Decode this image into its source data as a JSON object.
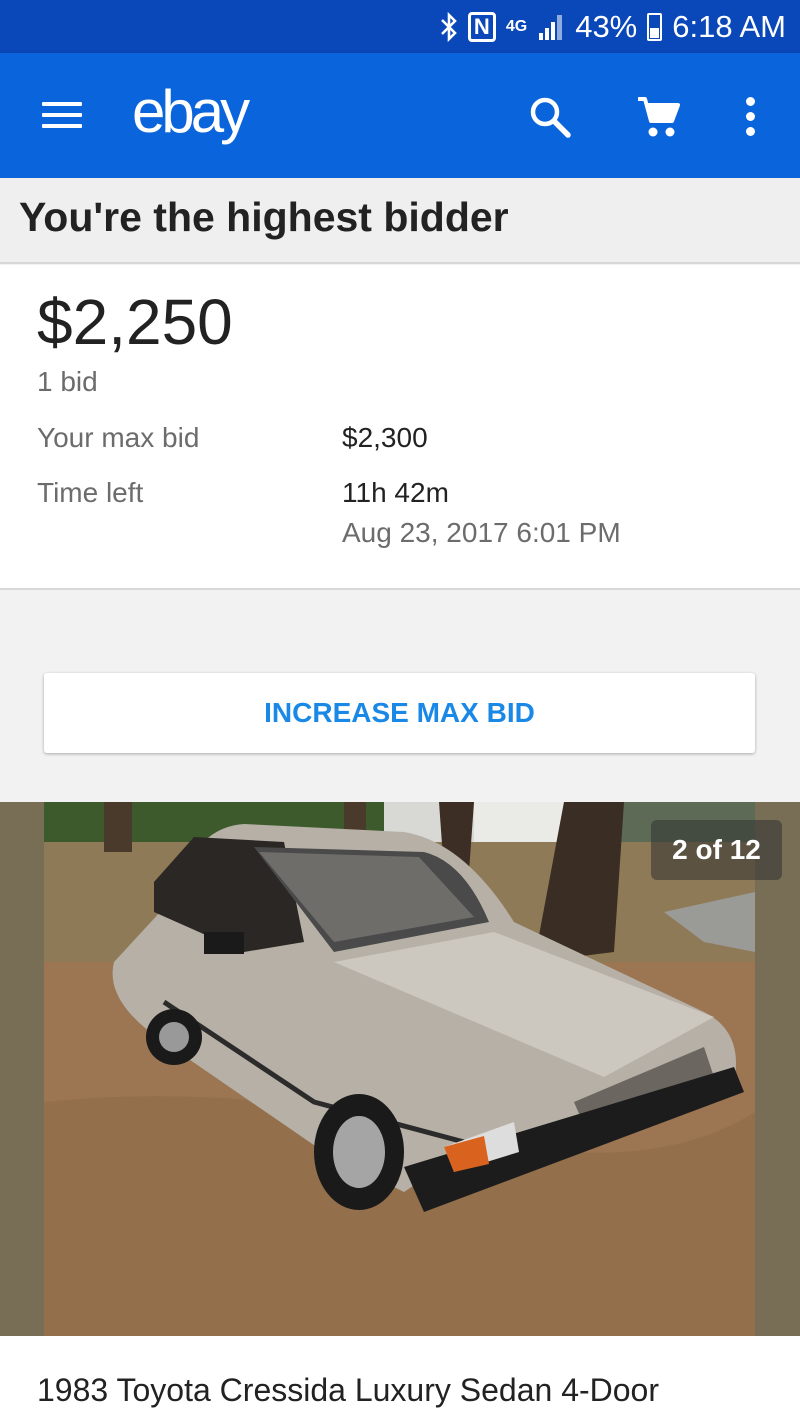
{
  "status_bar": {
    "battery_text": "43%",
    "time": "6:18 AM",
    "network": "4G",
    "battery_level": 0.43,
    "icons": [
      "bluetooth-icon",
      "nfc-icon",
      "network-4g-icon",
      "signal-icon",
      "battery-charging-icon"
    ]
  },
  "app_bar": {
    "logo": "ebay",
    "icons": [
      "menu-icon",
      "search-icon",
      "cart-icon",
      "more-options-icon"
    ],
    "background_color": "#0a64dc"
  },
  "bid_status": {
    "heading": "You're the highest bidder"
  },
  "bid_details": {
    "current_price": "$2,250",
    "bid_count": "1 bid",
    "max_bid_label": "Your max bid",
    "max_bid_value": "$2,300",
    "time_left_label": "Time left",
    "time_left_value": "11h 42m",
    "end_date": "Aug 23, 2017 6:01 PM"
  },
  "actions": {
    "increase_max_bid": "INCREASE MAX BID",
    "accent_color": "#1a88e6"
  },
  "gallery": {
    "counter": "2 of 12",
    "image_subject": "silver sedan parked on dry grass under trees"
  },
  "listing": {
    "title": "1983 Toyota Cressida Luxury Sedan 4-Door"
  }
}
